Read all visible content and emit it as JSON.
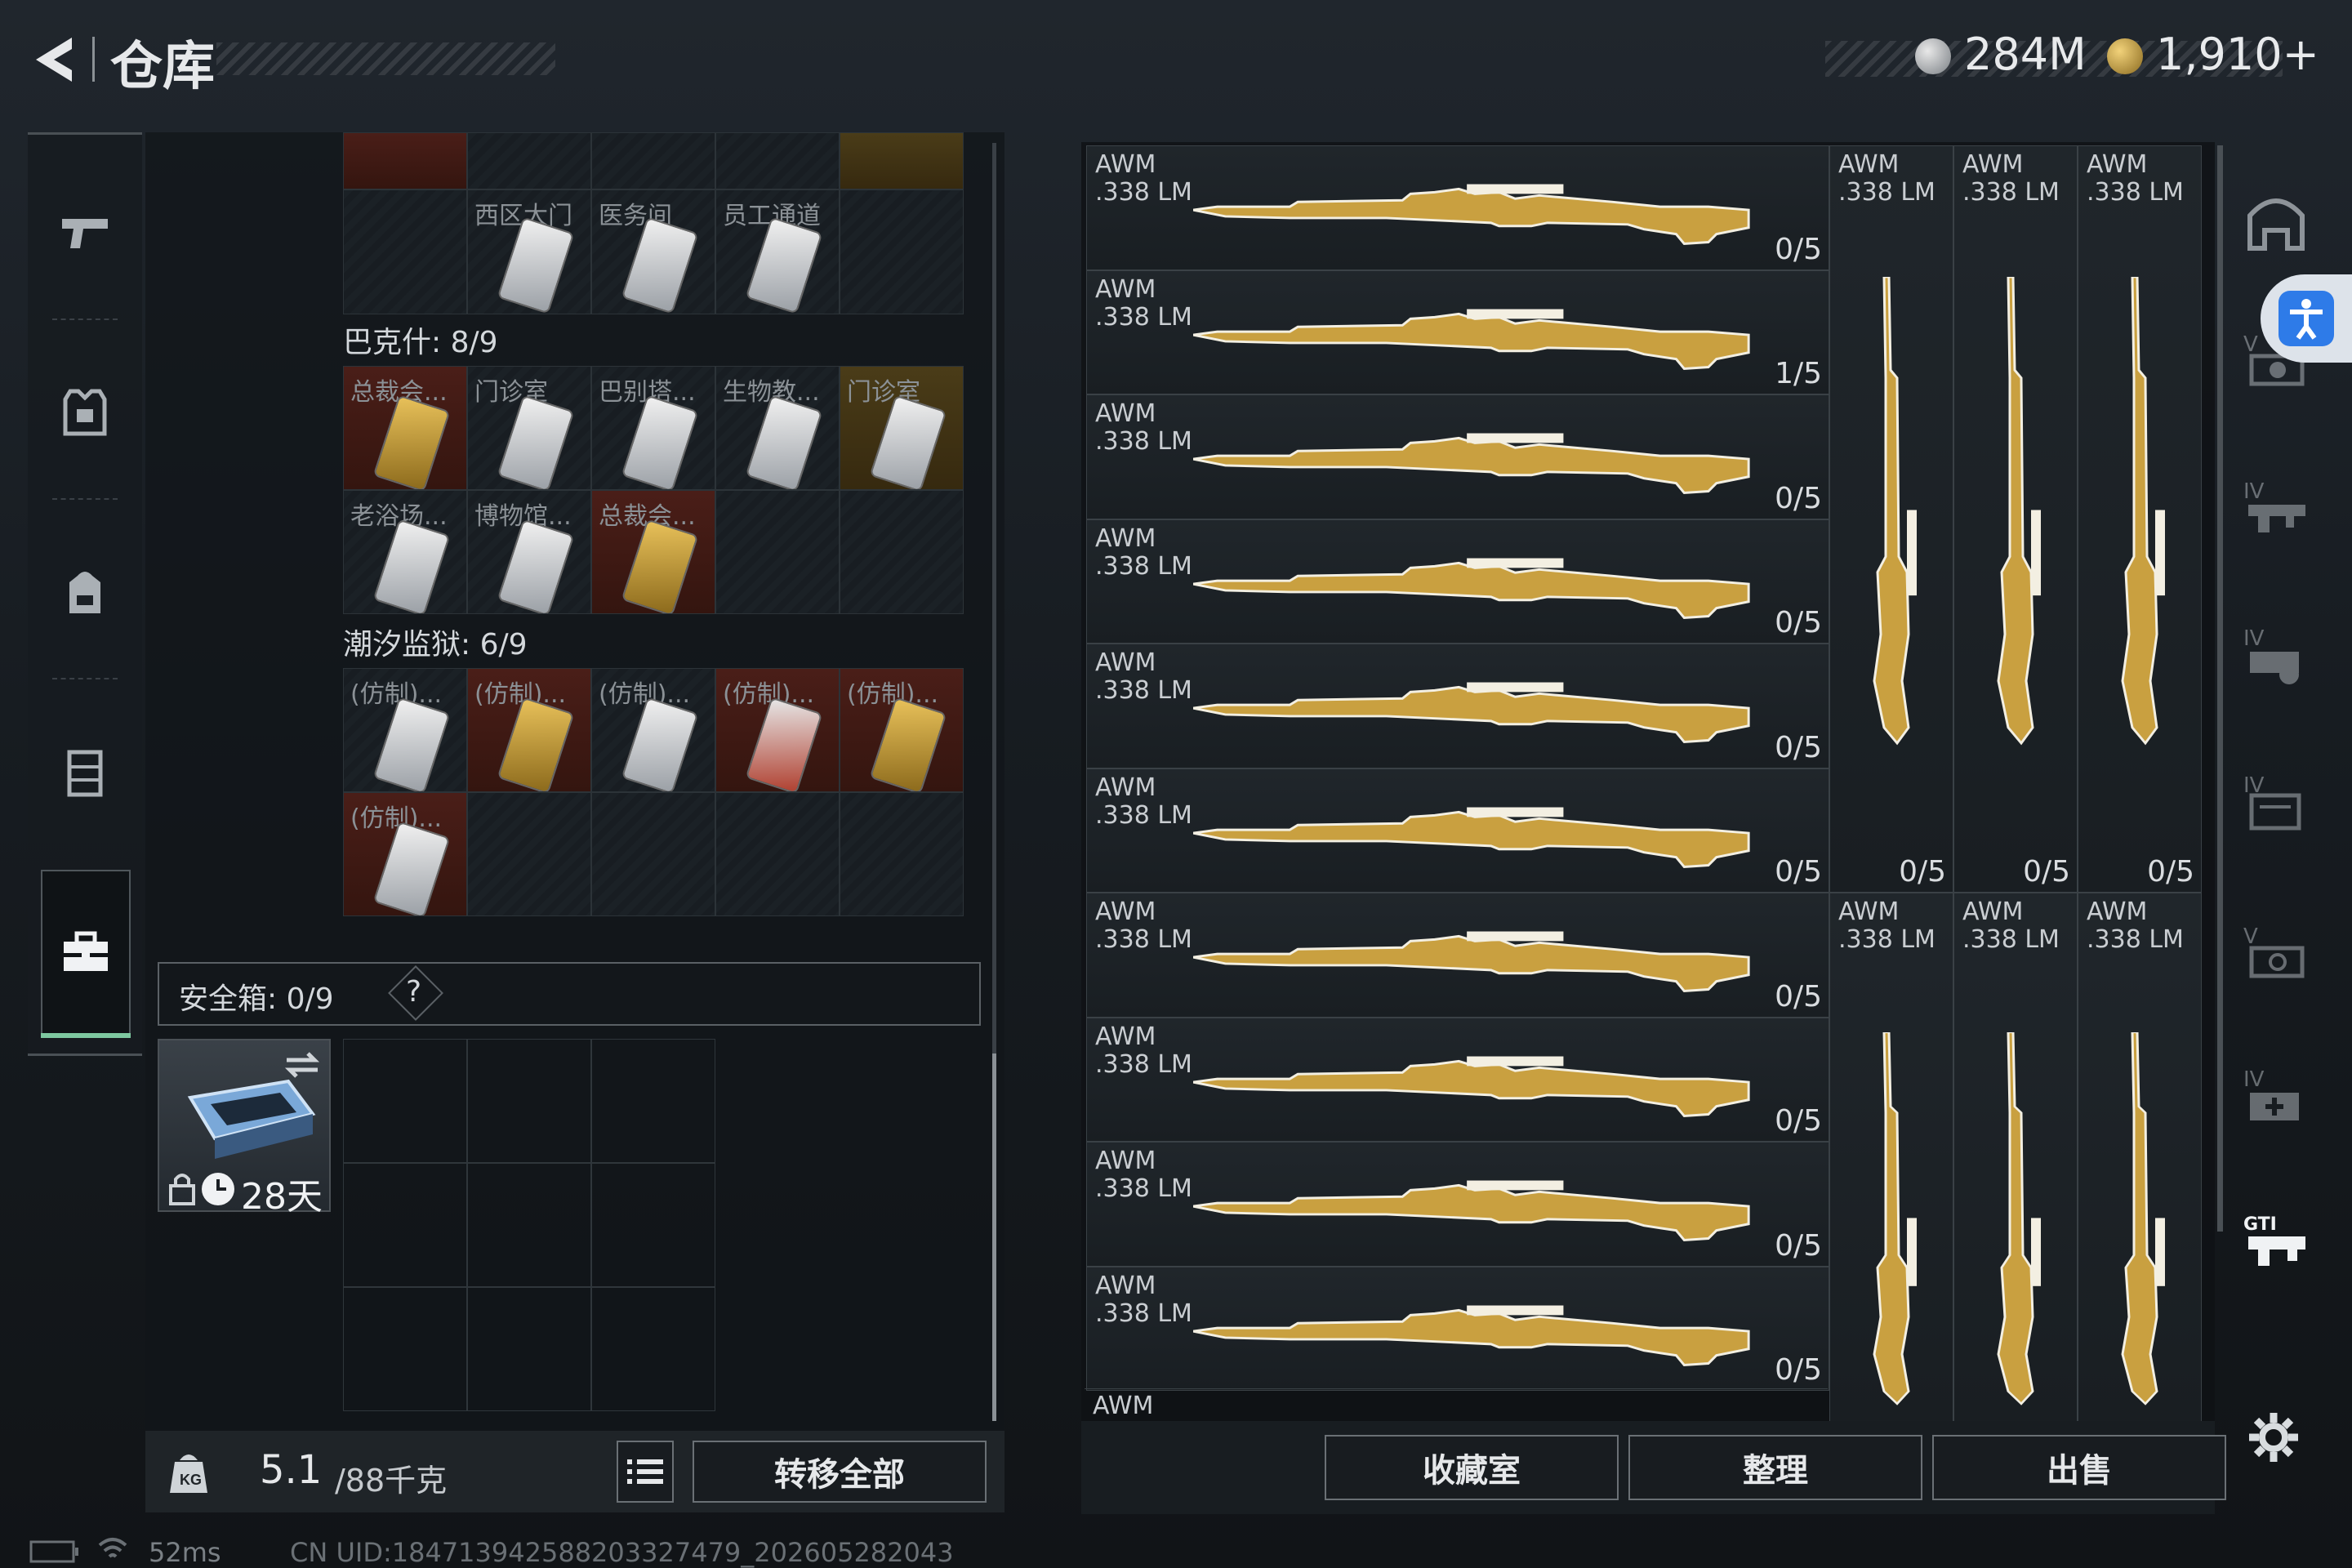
{
  "header": {
    "title": "仓库",
    "currency1": "284M",
    "currency2": "1,910+"
  },
  "left_nav": {
    "items": [
      "weapon-tab",
      "armor-tab",
      "backpack-tab",
      "rig-tab",
      "case-tab"
    ]
  },
  "storage": {
    "top_labels": [
      "西区大门",
      "医务间",
      "员工通道"
    ],
    "bakshi_label": "巴克什: 8/9",
    "bakshi_cells": [
      "总裁会...",
      "门诊室",
      "巴别塔...",
      "生物教...",
      "门诊室",
      "老浴场...",
      "博物馆...",
      "总裁会..."
    ],
    "tide_label": "潮汐监狱: 6/9",
    "tide_cells": [
      "(仿制)...",
      "(仿制)...",
      "(仿制)...",
      "(仿制)...",
      "(仿制)...",
      "(仿制)..."
    ],
    "safe_label": "安全箱: 0/9",
    "safe_help": "?",
    "safe_item_days": "28天",
    "weight_value": "5.1",
    "weight_max": "/88千克",
    "transfer_all": "转移全部"
  },
  "weapons": {
    "name_line1": "AWM",
    "name_line2": ".338 LM",
    "rows": [
      {
        "count": "0/5"
      },
      {
        "count": "1/5"
      },
      {
        "count": "0/5"
      },
      {
        "count": "0/5"
      },
      {
        "count": "0/5"
      },
      {
        "count": "0/5"
      },
      {
        "count": "0/5"
      },
      {
        "count": "0/5"
      },
      {
        "count": "0/5"
      },
      {
        "count": "0/5"
      }
    ],
    "partial_row_label": "AWM",
    "vertical_top_counts": [
      "0/5",
      "0/5",
      "0/5"
    ],
    "vertical_labels": [
      "AWM",
      ".338 LM"
    ]
  },
  "buttons": {
    "collection": "收藏室",
    "organize": "整理",
    "sell": "出售"
  },
  "status": {
    "ping": "52ms",
    "uid": "CN UID:18471394258820332747​9_202605282043"
  },
  "colors": {
    "accent_green": "#7ec8a0",
    "accessibility_blue": "#2e7be8",
    "gold": "#c9a040"
  }
}
